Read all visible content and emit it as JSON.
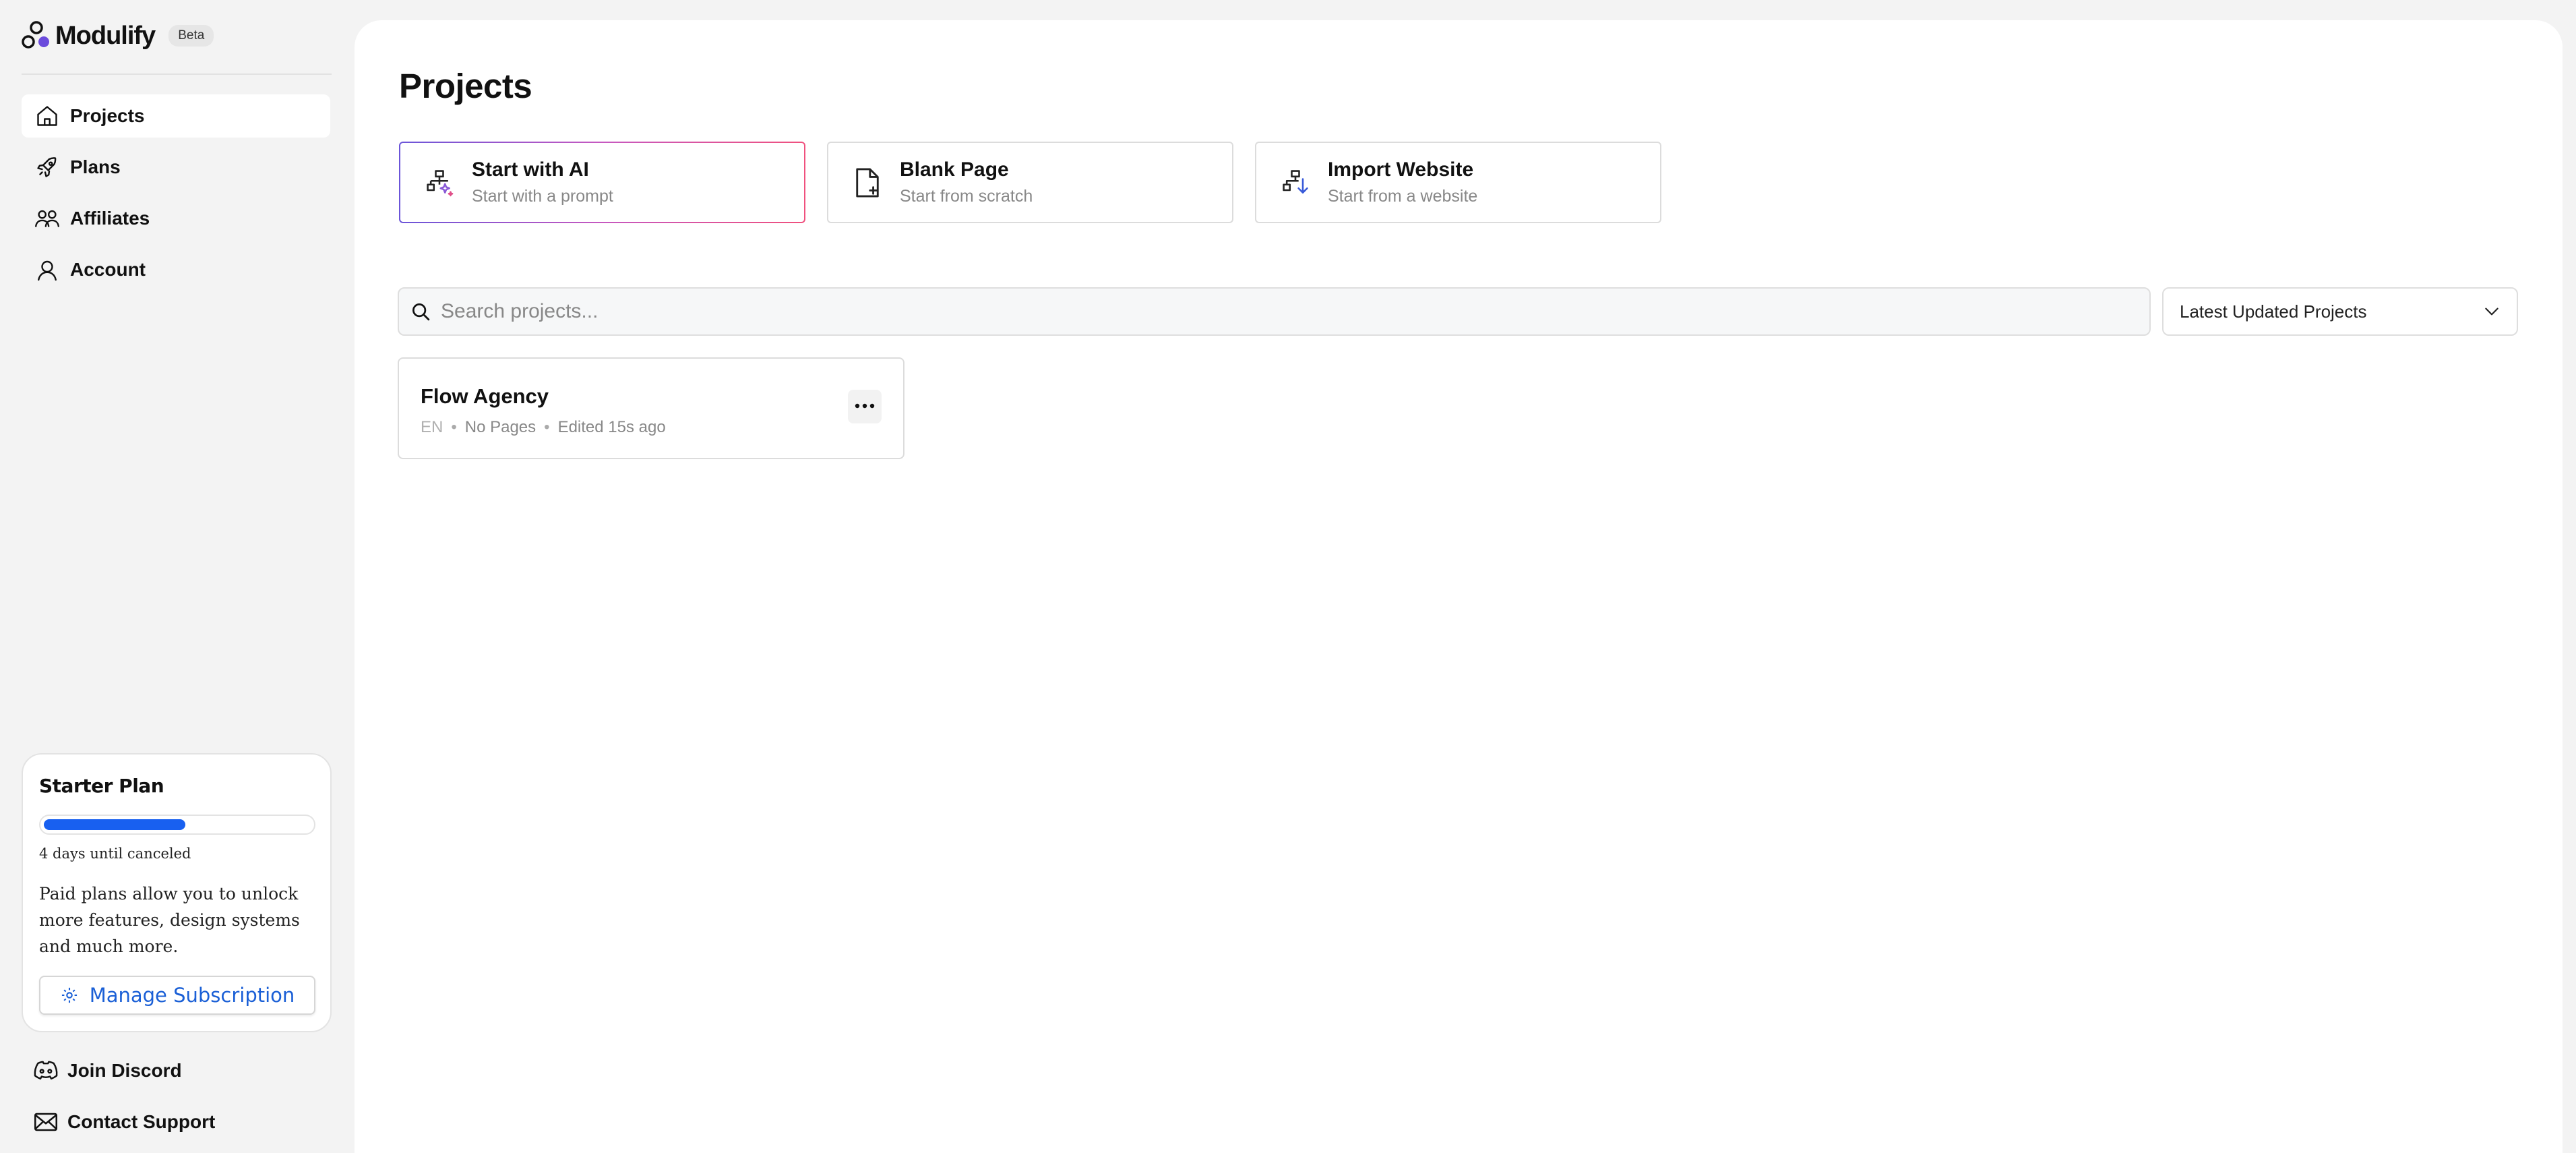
{
  "brand": {
    "name": "Modulify",
    "badge": "Beta"
  },
  "sidebar": {
    "nav": [
      {
        "label": "Projects",
        "icon": "home-icon",
        "active": true
      },
      {
        "label": "Plans",
        "icon": "rocket-icon",
        "active": false
      },
      {
        "label": "Affiliates",
        "icon": "users-icon",
        "active": false
      },
      {
        "label": "Account",
        "icon": "user-icon",
        "active": false
      }
    ],
    "plan": {
      "title": "Starter Plan",
      "progress_percent": 53,
      "days_text": "4 days until canceled",
      "description": "Paid plans allow you to unlock more features, design systems and much more.",
      "manage_label": "Manage Subscription"
    },
    "footer": [
      {
        "label": "Join Discord",
        "icon": "discord-icon"
      },
      {
        "label": "Contact Support",
        "icon": "mail-icon"
      }
    ]
  },
  "main": {
    "title": "Projects",
    "start_options": [
      {
        "title": "Start with AI",
        "subtitle": "Start with a prompt",
        "icon": "ai-sitemap-icon"
      },
      {
        "title": "Blank Page",
        "subtitle": "Start from scratch",
        "icon": "blank-page-icon"
      },
      {
        "title": "Import Website",
        "subtitle": "Start from a website",
        "icon": "import-sitemap-icon"
      }
    ],
    "search": {
      "placeholder": "Search projects...",
      "value": ""
    },
    "sort": {
      "selected": "Latest Updated Projects"
    },
    "projects": [
      {
        "name": "Flow Agency",
        "language": "EN",
        "pages": "No Pages",
        "edited": "Edited 15s ago"
      }
    ]
  },
  "colors": {
    "accent": "#1860f0",
    "ai_gradient_start": "#6b55d9",
    "ai_gradient_end": "#f0517e"
  }
}
